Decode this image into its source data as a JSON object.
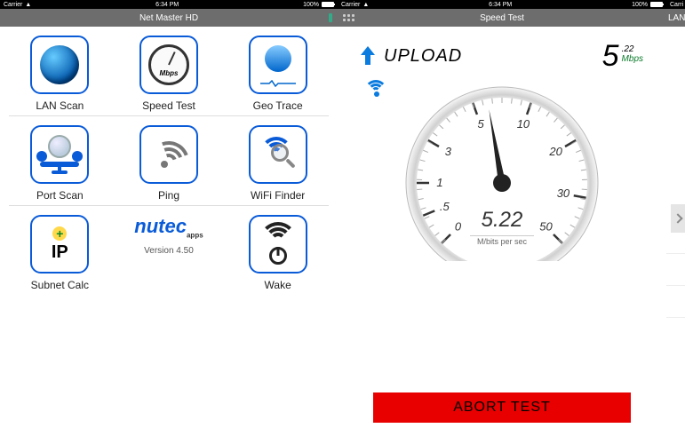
{
  "status_bar": {
    "carrier": "Carrier",
    "wifi_icon": "wifi-icon",
    "time": "6:34 PM",
    "battery_pct": "100%"
  },
  "left": {
    "title": "Net Master HD",
    "tiles": [
      {
        "name": "lan-scan",
        "label": "LAN Scan"
      },
      {
        "name": "speed-test",
        "label": "Speed Test",
        "inner_label": "Mbps"
      },
      {
        "name": "geo-trace",
        "label": "Geo Trace"
      },
      {
        "name": "port-scan",
        "label": "Port Scan"
      },
      {
        "name": "ping",
        "label": "Ping"
      },
      {
        "name": "wifi-finder",
        "label": "WiFi Finder"
      },
      {
        "name": "subnet-calc",
        "label": "Subnet Calc",
        "inner_label": "IP"
      },
      {
        "name": "logo",
        "brand": "nutec",
        "brand_sub": "apps",
        "version": "Version 4.50"
      },
      {
        "name": "wake",
        "label": "Wake"
      }
    ]
  },
  "mid": {
    "title": "Speed Test",
    "direction_label": "UPLOAD",
    "speed_value_int": "5",
    "speed_value_frac": ".22",
    "speed_unit": "Mbps",
    "gauge": {
      "value_text": "5.22",
      "unit_text": "M/bits per sec",
      "ticks": [
        {
          "label": "0",
          "angle": -135
        },
        {
          "label": ".5",
          "angle": -112.5
        },
        {
          "label": "1",
          "angle": -90
        },
        {
          "label": "3",
          "angle": -60
        },
        {
          "label": "5",
          "angle": -20
        },
        {
          "label": "10",
          "angle": 20
        },
        {
          "label": "20",
          "angle": 60
        },
        {
          "label": "30",
          "angle": 100
        },
        {
          "label": "50",
          "angle": 135
        }
      ],
      "needle_angle": -10
    },
    "abort_label": "ABORT TEST"
  },
  "right": {
    "title": "LAN"
  }
}
